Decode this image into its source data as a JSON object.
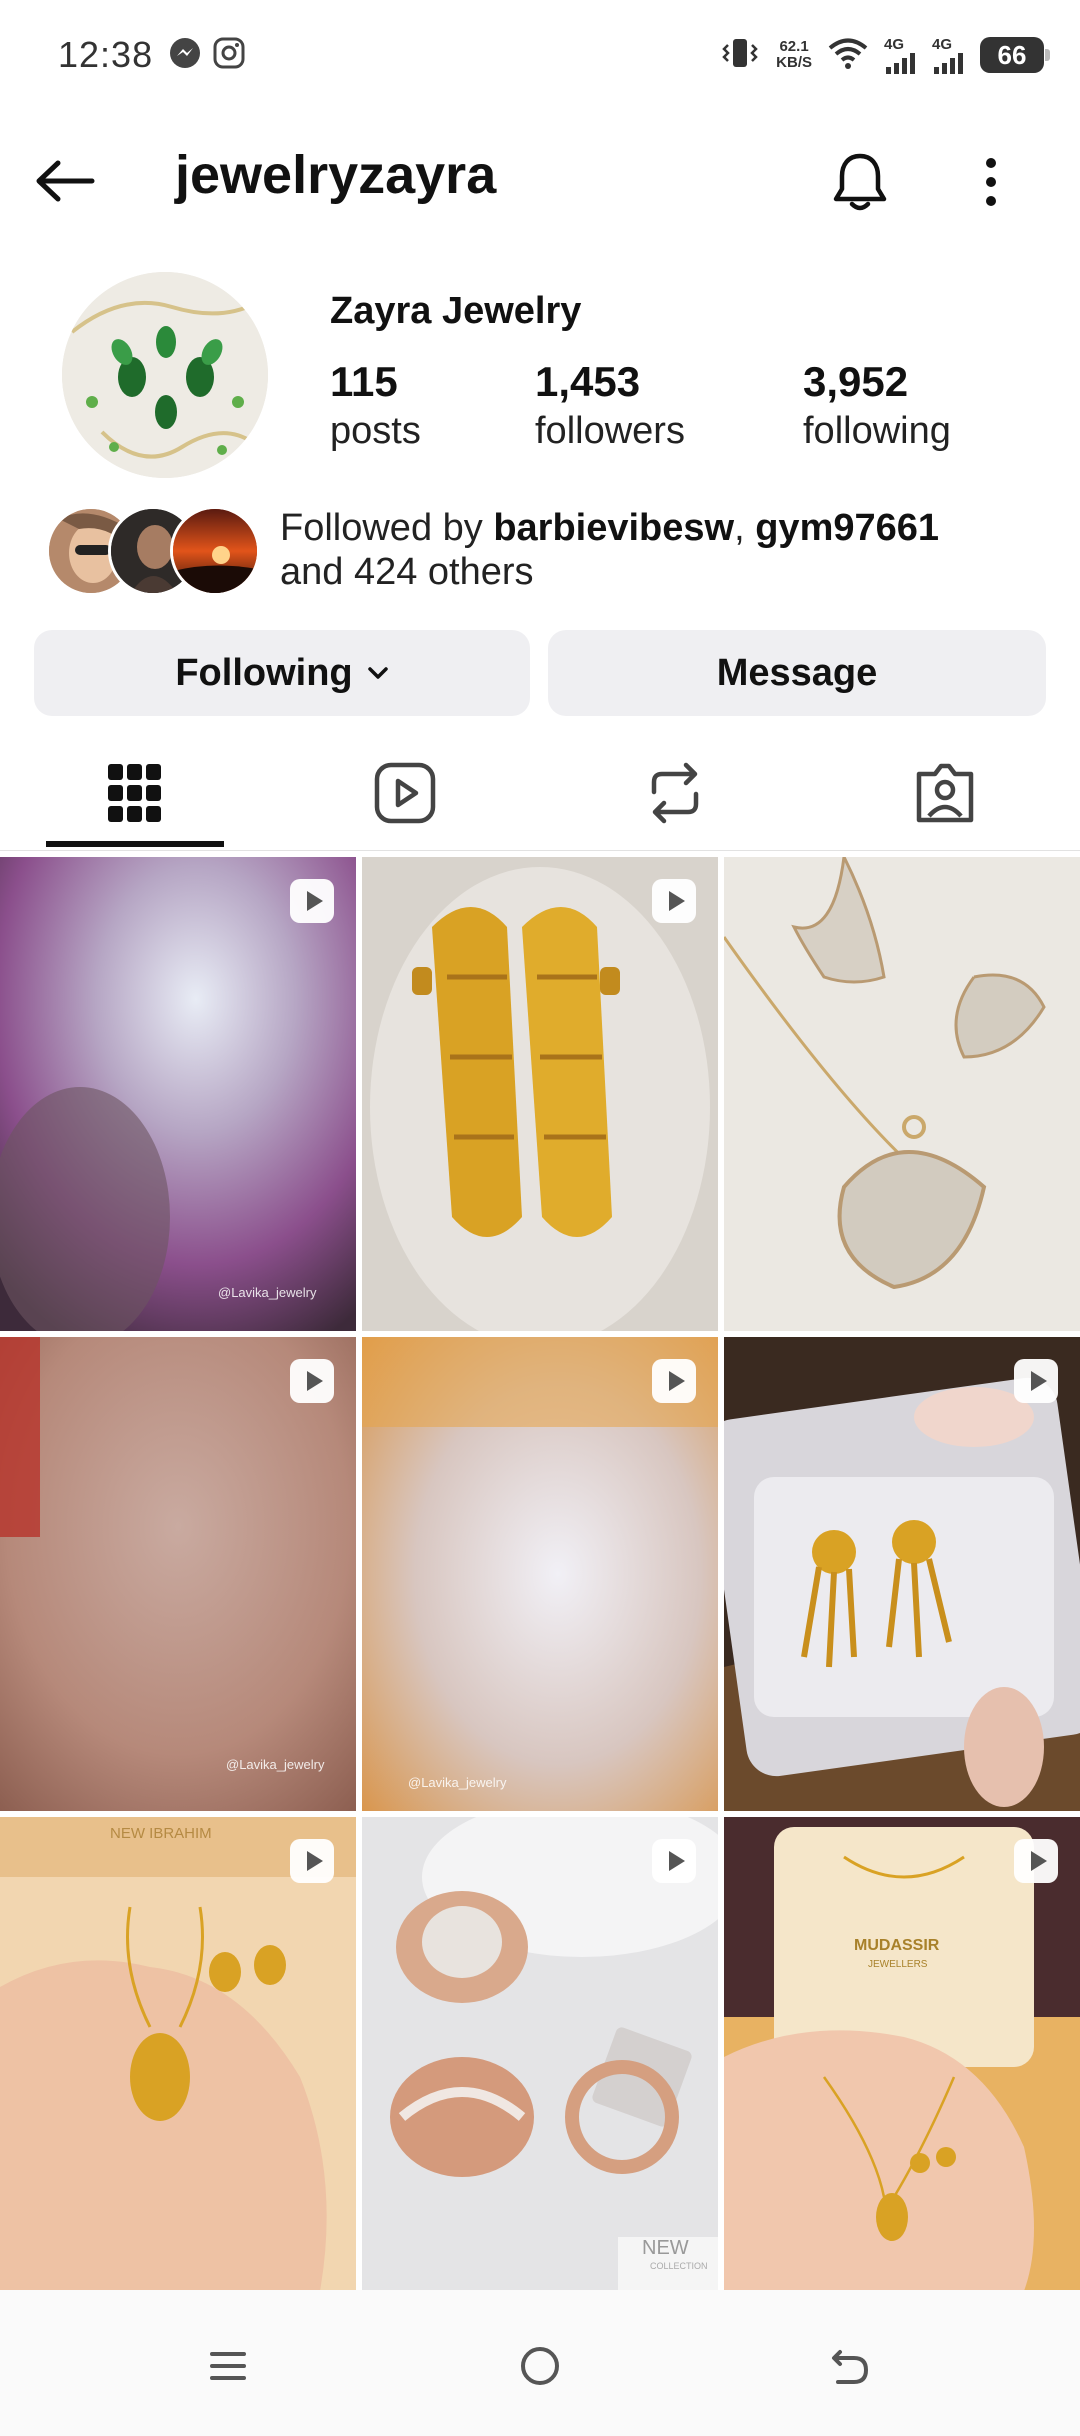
{
  "status_bar": {
    "time": "12:38",
    "net_speed_value": "62.1",
    "net_speed_unit": "KB/S",
    "signal_1": "4G",
    "signal_2": "4G",
    "battery": "66"
  },
  "header": {
    "username": "jewelryzayra"
  },
  "profile": {
    "display_name": "Zayra Jewelry",
    "stats": [
      {
        "value": "115",
        "label": "posts"
      },
      {
        "value": "1,453",
        "label": "followers"
      },
      {
        "value": "3,952",
        "label": "following"
      }
    ],
    "followed_by": {
      "prefix": "Followed by ",
      "user_1": "barbievibesw",
      "separator": ", ",
      "user_2": "gym97661",
      "suffix": "and 424 others"
    }
  },
  "actions": {
    "following_label": "Following",
    "message_label": "Message"
  },
  "tabs": [
    {
      "icon": "grid-icon",
      "active": true
    },
    {
      "icon": "reels-icon",
      "active": false
    },
    {
      "icon": "repost-icon",
      "active": false
    },
    {
      "icon": "tagged-icon",
      "active": false
    }
  ],
  "grid": {
    "watermark_1": "@Lavika_jewelry",
    "watermark_2": "@Lavika_jewelry",
    "watermark_3": "@Lavika_jewelry",
    "shop_sign_1": "NEW IBRAHIM",
    "shop_sign_2": "MUDASSIR",
    "shop_sign_2_sub": "JEWELLERS",
    "collection_tag": "NEW",
    "collection_sub": "COLLECTION"
  },
  "colors": {
    "button_bg": "#efeff2",
    "text": "#111111",
    "gold": "#d9a224"
  }
}
